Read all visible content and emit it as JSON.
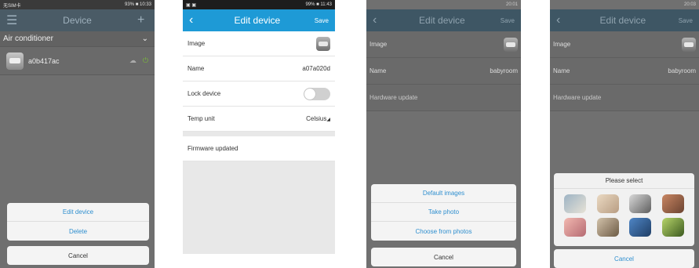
{
  "screen1": {
    "status_left": "无SIM卡",
    "status_right": "93% ■ 10:33",
    "menu_icon": "menu-icon",
    "title": "Device",
    "add_icon": "plus-icon",
    "category": "Air conditioner",
    "device": {
      "name": "a0b417ac"
    },
    "sheet": [
      "Edit device",
      "Delete"
    ],
    "cancel": "Cancel"
  },
  "screen2": {
    "status_right": "99% ■ 11:43",
    "title": "Edit device",
    "save": "Save",
    "rows": {
      "image": "Image",
      "name_label": "Name",
      "name_value": "a07a020d",
      "lock_label": "Lock device",
      "temp_label": "Temp unit",
      "temp_value": "Celsius",
      "firmware": "Firmware updated"
    },
    "lock_on": false
  },
  "screen3": {
    "status_right": "20:01",
    "title": "Edit device",
    "save": "Save",
    "image_label": "Image",
    "name_label": "Name",
    "name_value": "babyroom",
    "hardware": "Hardware update",
    "sheet": [
      "Default images",
      "Take photo",
      "Choose from photos"
    ],
    "cancel": "Cancel"
  },
  "screen4": {
    "status_right": "20:03",
    "title": "Edit device",
    "save": "Save",
    "image_label": "Image",
    "name_label": "Name",
    "name_value": "babyroom",
    "hardware": "Hardware update",
    "picker_title": "Please select",
    "cancel": "Cancel"
  }
}
